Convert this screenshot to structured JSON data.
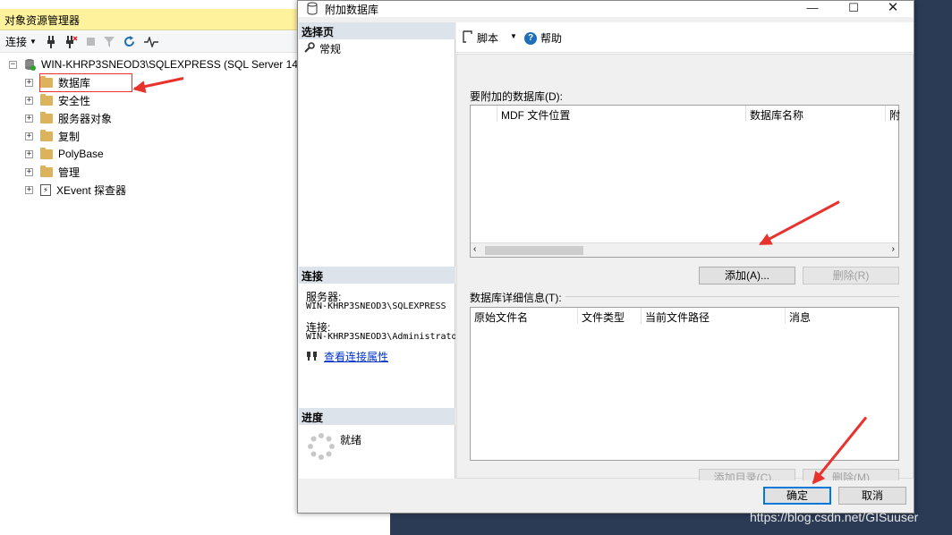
{
  "object_explorer": {
    "title": "对象资源管理器",
    "toolbar": {
      "connect": "连接"
    },
    "server_node": "WIN-KHRP3SNEOD3\\SQLEXPRESS (SQL Server 14",
    "nodes": [
      "数据库",
      "安全性",
      "服务器对象",
      "复制",
      "PolyBase",
      "管理",
      "XEvent 探查器"
    ]
  },
  "dialog": {
    "title": "附加数据库",
    "select_page": {
      "header": "选择页",
      "items": [
        "常规"
      ]
    },
    "connection": {
      "header": "连接",
      "server_label": "服务器:",
      "server_value": "WIN-KHRP3SNEOD3\\SQLEXPRESS",
      "conn_label": "连接:",
      "conn_value": "WIN-KHRP3SNEOD3\\Administrato",
      "view_props": "查看连接属性"
    },
    "progress": {
      "header": "进度",
      "status": "就绪"
    },
    "toolbar": {
      "script": "脚本",
      "help": "帮助"
    },
    "attach_section": {
      "label": "要附加的数据库(D):",
      "columns": [
        "MDF 文件位置",
        "数据库名称",
        "附"
      ],
      "add_button": "添加(A)...",
      "remove_button": "删除(R)"
    },
    "details_section": {
      "label": "数据库详细信息(T):",
      "columns": [
        "原始文件名",
        "文件类型",
        "当前文件路径",
        "消息"
      ],
      "add_catalog_button": "添加目录(C)...",
      "remove_button": "删除(M)"
    },
    "footer": {
      "ok": "确定",
      "cancel": "取消"
    }
  },
  "watermark": "https://blog.csdn.net/GISuuser",
  "colors": {
    "annotation_red": "#e8322d",
    "title_yellow": "#fff29d",
    "link_blue": "#0033cc"
  }
}
